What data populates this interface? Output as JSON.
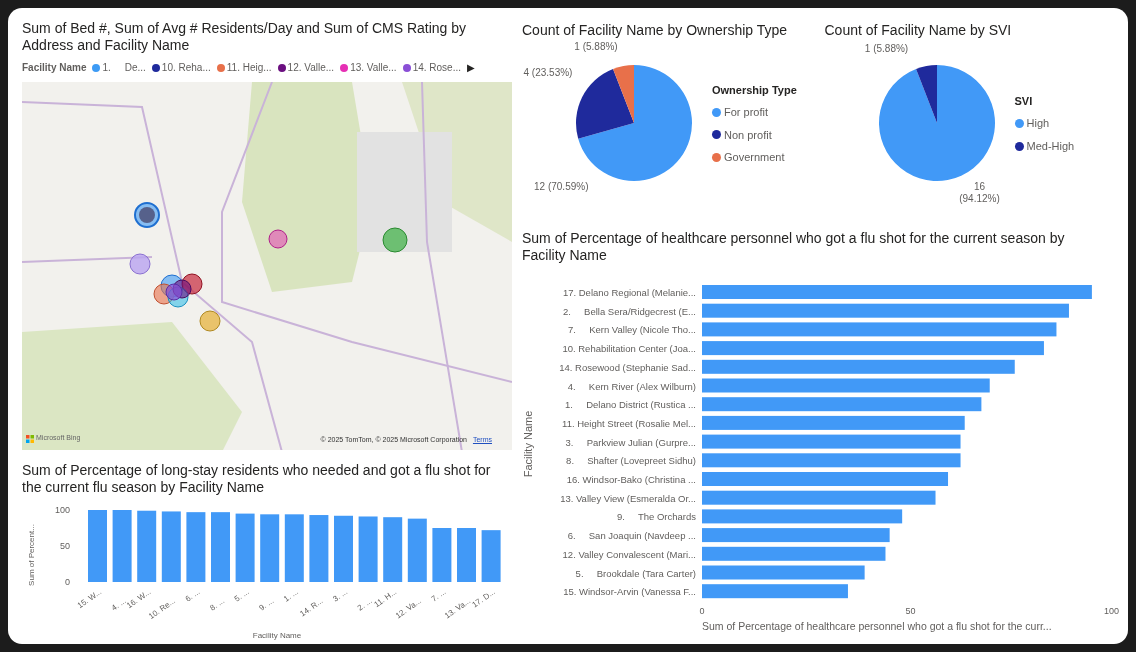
{
  "map_visual": {
    "title": "Sum of Bed #, Sum of Avg # Residents/Day and Sum of CMS Rating by Address and Facility Name",
    "legend": {
      "title": "Facility Name",
      "next_icon": "▶",
      "items": [
        {
          "label": "1.     De...",
          "color": "#3d9bf5"
        },
        {
          "label": "10. Reha...",
          "color": "#1f2a9c"
        },
        {
          "label": "11. Heig...",
          "color": "#e8704a"
        },
        {
          "label": "12. Valle...",
          "color": "#6b0f80"
        },
        {
          "label": "13. Valle...",
          "color": "#e62fb4"
        },
        {
          "label": "14. Rose...",
          "color": "#8a4fd6"
        }
      ]
    },
    "bing_label": "Microsoft Bing",
    "attribution": "© 2025 TomTom, © 2025 Microsoft Corporation",
    "terms_link": "Terms"
  },
  "long_stay_chart": {
    "title": "Sum of Percentage of long-stay residents who needed and got a flu shot for the current flu season by Facility Name",
    "chart_data": {
      "type": "bar",
      "xlabel": "Facility Name",
      "ylabel": "Sum of Percent...",
      "yticks": [
        0,
        50,
        100
      ],
      "ylim": [
        0,
        100
      ],
      "categories": [
        "15. W...",
        "4. ...",
        "16. W...",
        "10. Re...",
        "6. ...",
        "8. ...",
        "5. ...",
        "9. ...",
        "1. ...",
        "14. R...",
        "3. ...",
        "2. ...",
        "11. H...",
        "12. Va...",
        "7. ...",
        "13. Va...",
        "17. D..."
      ],
      "values": [
        100,
        100,
        99,
        98,
        97,
        97,
        95,
        94,
        94,
        93,
        92,
        91,
        90,
        88,
        75,
        75,
        72
      ]
    }
  },
  "ownership_chart": {
    "title": "Count of Facility Name by Ownership Type",
    "legend_title": "Ownership Type",
    "chart_data": {
      "type": "pie",
      "categories": [
        "For profit",
        "Non profit",
        "Government"
      ],
      "values": [
        70.59,
        23.53,
        5.88
      ],
      "colors": [
        "#4199f7",
        "#1f2a9c",
        "#e8704a"
      ],
      "value_labels": [
        "12 (70.59%)",
        "4 (23.53%)",
        "1 (5.88%)"
      ]
    }
  },
  "svi_chart": {
    "title": "Count of Facility Name by SVI",
    "legend_title": "SVI",
    "chart_data": {
      "type": "pie",
      "categories": [
        "High",
        "Med-High"
      ],
      "values": [
        94.12,
        5.88
      ],
      "colors": [
        "#4199f7",
        "#1f2a9c"
      ],
      "value_labels": [
        "16 (94.12%)",
        "1 (5.88%)"
      ]
    }
  },
  "personnel_chart": {
    "title": "Sum of Percentage of healthcare personnel who got a flu shot for the current season by Facility Name",
    "chart_data": {
      "type": "bar",
      "orientation": "horizontal",
      "ylabel": "Facility Name",
      "xlabel": "Sum of Percentage of healthcare personnel who got a flu shot for the curr...",
      "xticks": [
        0,
        50,
        100
      ],
      "xlim": [
        0,
        100
      ],
      "categories": [
        "17. Delano Regional (Melanie...",
        "2.     Bella Sera/Ridgecrest (E...",
        "7.     Kern Valley (Nicole Tho...",
        "10. Rehabilitation Center (Joa...",
        "14. Rosewood (Stephanie Sad...",
        "4.     Kern River (Alex Wilburn)",
        "1.     Delano District (Rustica ...",
        "11. Height Street (Rosalie Mel...",
        "3.     Parkview Julian (Gurpre...",
        "8.     Shafter (Lovepreet Sidhu)",
        "16. Windsor-Bako (Christina ...",
        "13. Valley View (Esmeralda Or...",
        "9.     The Orchards",
        "6.     San Joaquin (Navdeep ...",
        "12. Valley Convalescent (Mari...",
        "5.     Brookdale (Tara Carter)",
        "15. Windsor-Arvin (Vanessa F..."
      ],
      "values": [
        93.5,
        88,
        85,
        82,
        75,
        69,
        67,
        63,
        62,
        62,
        59,
        56,
        48,
        45,
        44,
        39,
        35
      ]
    }
  }
}
